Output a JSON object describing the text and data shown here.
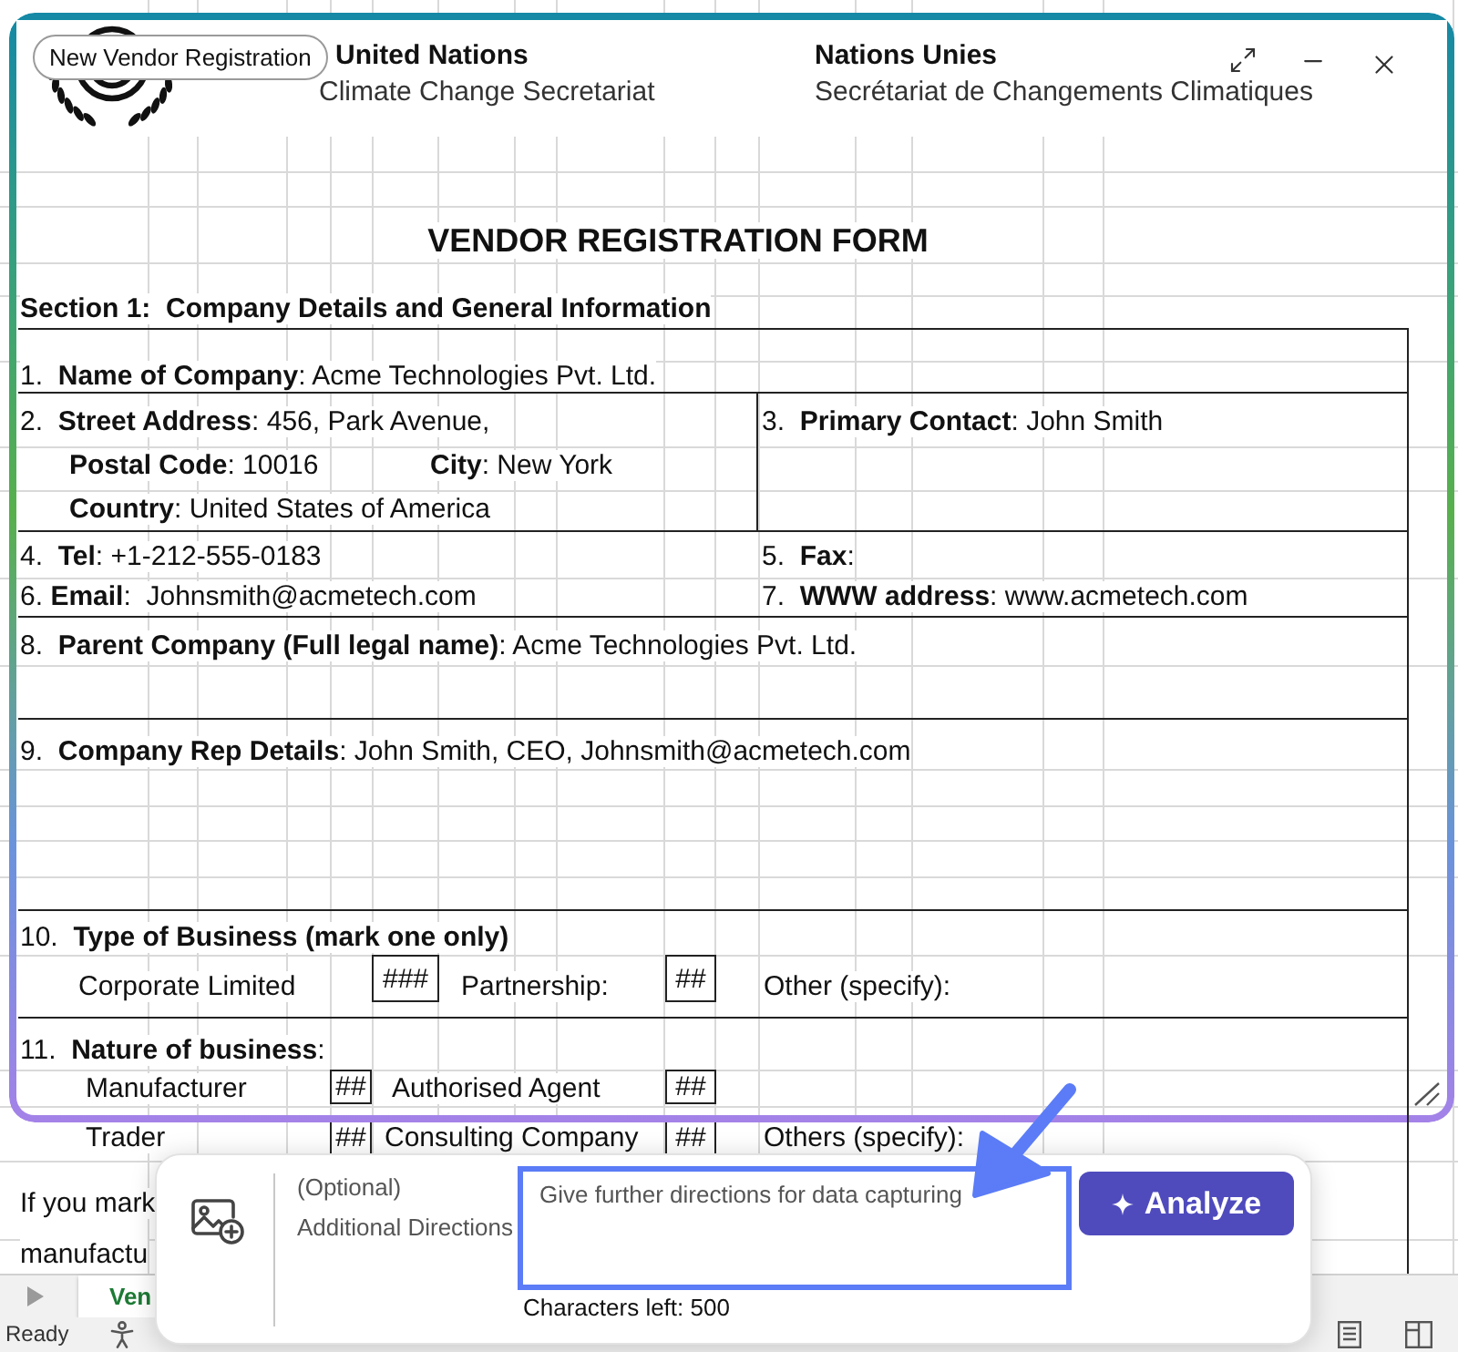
{
  "capture_frame": {
    "tag": "New Vendor Registration"
  },
  "letterhead": {
    "english": {
      "name": "United Nations",
      "unit": "Climate Change Secretariat"
    },
    "french": {
      "name": "Nations Unies",
      "unit": "Secrétariat de Changements Climatiques"
    }
  },
  "form": {
    "title": "VENDOR REGISTRATION FORM",
    "section": "Section 1:  Company Details and General Information",
    "rows": [
      {
        "kind": "single",
        "lines": [
          "1.  **Name of Company**: Acme Technologies Pvt. Ltd."
        ]
      },
      {
        "kind": "split",
        "left": [
          [
            "2.  **Street Address**: 456, Park Avenue,"
          ],
          [
            "**Postal Code**: 10016",
            "**City**: New York"
          ],
          [
            "**Country**: United States of America"
          ]
        ],
        "right": [
          "3.  **Primary Contact**: John Smith"
        ]
      },
      {
        "kind": "pairs",
        "lines": [
          [
            "4.  **Tel**: +1-212-555-0183",
            "5.  **Fax**:"
          ],
          [
            "6. **Email**:  Johnsmith@acmetech.com",
            "7.  **WWW address**: www.acmetech.com"
          ]
        ]
      },
      {
        "kind": "single",
        "lines": [
          "8.  **Parent Company (Full legal name)**: Acme Technologies Pvt. Ltd."
        ]
      },
      {
        "kind": "single",
        "lines": [
          "9.  **Company Rep Details**: John Smith, CEO, Johnsmith@acmetech.com"
        ]
      },
      {
        "kind": "choices",
        "heading": "10.  **Type of Business (mark one only)**",
        "options": [
          [
            {
              "kind": "label",
              "text": "Corporate Limited"
            },
            {
              "kind": "mark",
              "text": "###"
            },
            {
              "kind": "label",
              "text": "Partnership:"
            },
            {
              "kind": "mark",
              "text": "##"
            },
            {
              "kind": "label",
              "text": "Other (specify):"
            }
          ]
        ]
      },
      {
        "kind": "choices",
        "heading": "11.  **Nature of business**:",
        "options": [
          [
            {
              "kind": "label",
              "text": "Manufacturer"
            },
            {
              "kind": "mark",
              "text": "##"
            },
            {
              "kind": "label",
              "text": "Authorised Agent"
            },
            {
              "kind": "mark",
              "text": "##"
            }
          ],
          [
            {
              "kind": "label",
              "text": "Trader"
            },
            {
              "kind": "mark",
              "text": "##"
            },
            {
              "kind": "label",
              "text": "Consulting Company"
            },
            {
              "kind": "mark",
              "text": "##"
            },
            {
              "kind": "label",
              "text": "Others (specify):"
            }
          ]
        ],
        "notes": [
          "If you mark",
          "manufactu"
        ]
      }
    ]
  },
  "directions_panel": {
    "optional_label": "(Optional)",
    "label": "Additional Directions",
    "placeholder": "Give further directions for data capturing",
    "counter": "Characters left: 500",
    "button": "Analyze"
  },
  "sheet_tabs": [
    {
      "label": "Ven",
      "selected": true
    }
  ],
  "status_bar": {
    "text": "Ready"
  }
}
